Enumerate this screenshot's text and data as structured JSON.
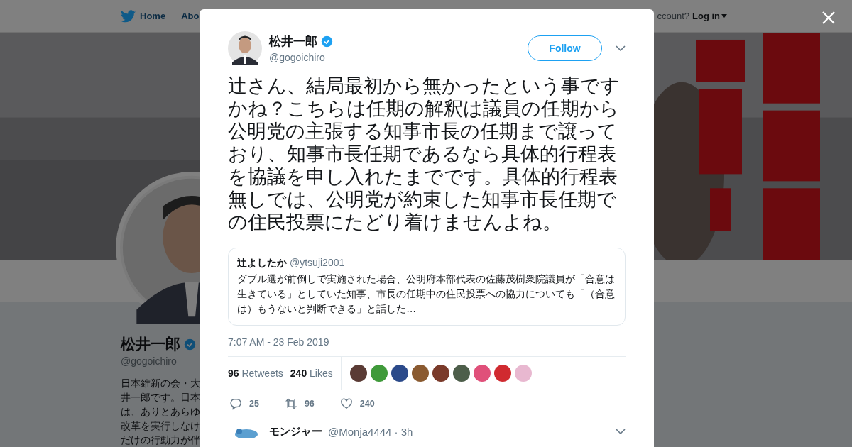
{
  "nav": {
    "home": "Home",
    "about": "Abo",
    "account_prompt": "ccount?",
    "login": "Log in"
  },
  "profile": {
    "name": "松井一郎",
    "handle": "@gogoichiro",
    "bio_lines": [
      "日本維新の会・大",
      "井一郎です。日本",
      "は、ありとあらゆ",
      "改革を実行しなけ",
      "だけの行動力が伴"
    ]
  },
  "tweet": {
    "name": "松井一郎",
    "handle": "@gogoichiro",
    "follow": "Follow",
    "text": "辻さん、結局最初から無かったという事ですかね？こちらは任期の解釈は議員の任期から公明党の主張する知事市長の任期まで譲っており、知事市長任期であるなら具体的行程表を協議を申し入れたまでです。具体的行程表無しでは、公明党が約束した知事市長任期での住民投票にたどり着けませんよね。",
    "quoted": {
      "name": "辻よしたか",
      "handle": "@ytsuji2001",
      "text": "ダブル選が前倒しで実施された場合、公明府本部代表の佐藤茂樹衆院議員が「合意は生きている」としていた知事、市長の任期中の住民投票への協力についても「（合意は）もうないと判断できる」と話した…"
    },
    "timestamp": "7:07 AM - 23 Feb 2019",
    "stats": [
      {
        "count": "96",
        "label": "Retweets"
      },
      {
        "count": "240",
        "label": "Likes"
      }
    ],
    "likers": [
      {
        "color": "#5a3b35"
      },
      {
        "color": "#3f9a3a"
      },
      {
        "color": "#2b4a8a"
      },
      {
        "color": "#8a5a30"
      },
      {
        "color": "#7a3a2a"
      },
      {
        "color": "#4d5e4a"
      },
      {
        "color": "#e0507a"
      },
      {
        "color": "#d02a30"
      },
      {
        "color": "#e8b8d0"
      }
    ],
    "actions": [
      {
        "kind": "reply",
        "count": "25"
      },
      {
        "kind": "retweet",
        "count": "96"
      },
      {
        "kind": "like",
        "count": "240"
      }
    ],
    "reply_preview": {
      "name": "モンジャー",
      "meta": "@Monja4444 · 3h"
    }
  }
}
